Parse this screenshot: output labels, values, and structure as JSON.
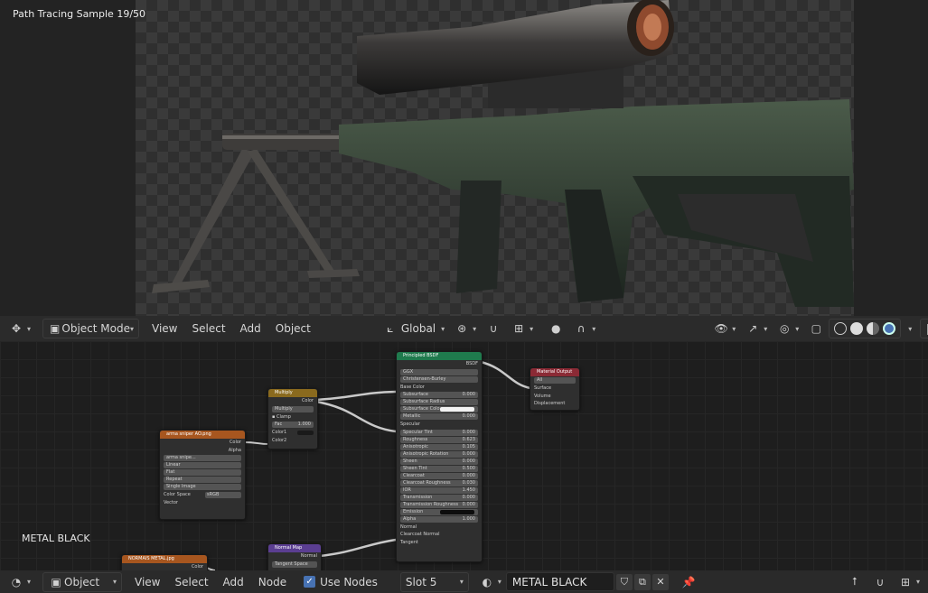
{
  "viewport": {
    "render_status": "Path Tracing Sample 19/50",
    "header": {
      "editor_icon": "globe-icon",
      "mode": "Object Mode",
      "menus": [
        "View",
        "Select",
        "Add",
        "Object"
      ],
      "orientation": "Global"
    }
  },
  "node_editor": {
    "material_label": "METAL BLACK",
    "nodes": {
      "principled": {
        "title": "Principled BSDF",
        "output": "BSDF",
        "distribution": "GGX",
        "subsurface_method": "Christensen-Burley",
        "base_color": "Base Color",
        "fields": [
          {
            "label": "Subsurface",
            "value": "0.000"
          },
          {
            "label": "Subsurface Radius",
            "value": ""
          },
          {
            "label": "Subsurface Colo",
            "value": ""
          },
          {
            "label": "Metallic",
            "value": "0.000"
          },
          {
            "label": "Specular",
            "value": ""
          },
          {
            "label": "Specular Tint",
            "value": "0.000"
          },
          {
            "label": "Roughness",
            "value": "0.623"
          },
          {
            "label": "Anisotropic",
            "value": "0.105"
          },
          {
            "label": "Anisotropic Rotation",
            "value": "0.000"
          },
          {
            "label": "Sheen",
            "value": "0.000"
          },
          {
            "label": "Sheen Tint",
            "value": "0.500"
          },
          {
            "label": "Clearcoat",
            "value": "0.000"
          },
          {
            "label": "Clearcoat Roughness",
            "value": "0.030"
          },
          {
            "label": "IOR",
            "value": "1.450"
          },
          {
            "label": "Transmission",
            "value": "0.000"
          },
          {
            "label": "Transmission Roughness",
            "value": "0.000"
          },
          {
            "label": "Emission",
            "value": ""
          },
          {
            "label": "Alpha",
            "value": "1.000"
          },
          {
            "label": "Normal",
            "value": ""
          },
          {
            "label": "Clearcoat Normal",
            "value": ""
          },
          {
            "label": "Tangent",
            "value": ""
          }
        ]
      },
      "output": {
        "title": "Material Output",
        "target": "All",
        "inputs": [
          "Surface",
          "Volume",
          "Displacement"
        ]
      },
      "multiply": {
        "title": "Multiply",
        "output": "Color",
        "blend": "Multiply",
        "clamp": "Clamp",
        "fac_label": "Fac",
        "fac_value": "1.000",
        "inputs": [
          "Color1",
          "Color2"
        ]
      },
      "image": {
        "title": "arma sniper AO.png",
        "outputs": [
          "Color",
          "Alpha"
        ],
        "image_name": "arma snipe...",
        "options": [
          "Linear",
          "Flat",
          "Repeat",
          "Single Image"
        ],
        "color_space_label": "Color Space",
        "color_space_value": "sRGB",
        "vector": "Vector"
      },
      "normal_map": {
        "title": "Normal Map",
        "output": "Normal",
        "space": "Tangent Space"
      },
      "normal_image": {
        "title": "NORMAIS METAL.jpg",
        "output": "Color"
      }
    },
    "header": {
      "editor_icon": "node-editor-icon",
      "object_type": "Object",
      "menus": [
        "View",
        "Select",
        "Add",
        "Node"
      ],
      "use_nodes": "Use Nodes",
      "slot": "Slot 5",
      "material_name": "METAL BLACK"
    }
  },
  "colors": {
    "shader_header": "#1f7a4d",
    "output_header": "#8b2a35",
    "color_header": "#8a6a1e",
    "texture_header": "#a7561f",
    "vector_header": "#5b3e92",
    "accent": "#4772b3"
  }
}
